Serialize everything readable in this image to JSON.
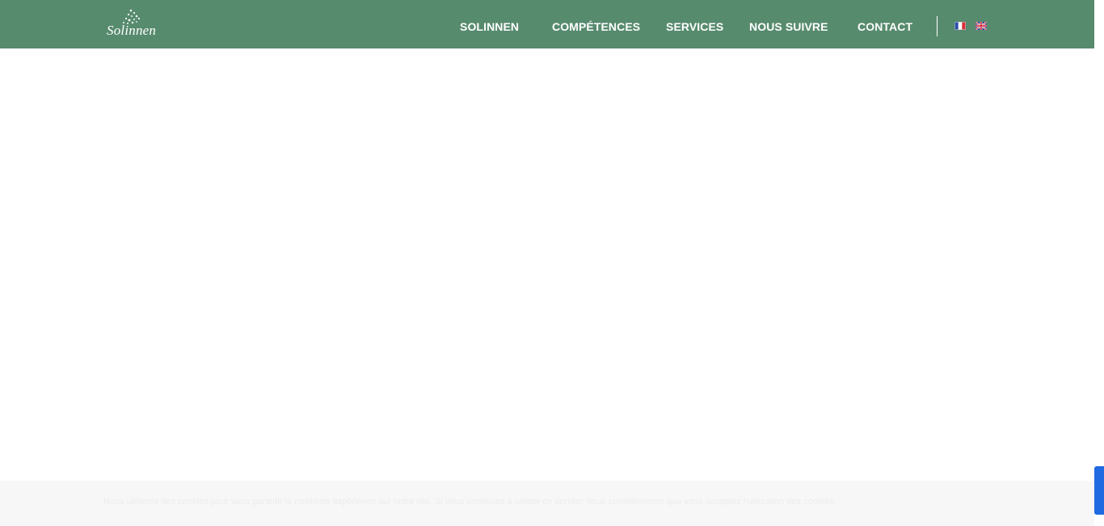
{
  "header": {
    "logo_text": "Solinnen",
    "nav": [
      {
        "label": "SOLINNEN"
      },
      {
        "label": "COMPÉTENCES"
      },
      {
        "label": "SERVICES"
      },
      {
        "label": "NOUS SUIVRE"
      },
      {
        "label": "CONTACT"
      }
    ],
    "languages": [
      {
        "icon": "flag-fr-icon"
      },
      {
        "icon": "flag-uk-icon"
      }
    ]
  },
  "cookie_notice": {
    "text": "Nous utilisons des cookies pour vous garantir la meilleure expérience sur notre site. Si vous continuez à utiliser ce dernier, nous considérerons que vous acceptez l'utilisation des cookies."
  },
  "colors": {
    "header_bg": "#578b6e",
    "text_on_header": "#ffffff",
    "cookie_bar_bg": "#f7f7f7",
    "side_tab": "#1f6ae0"
  }
}
